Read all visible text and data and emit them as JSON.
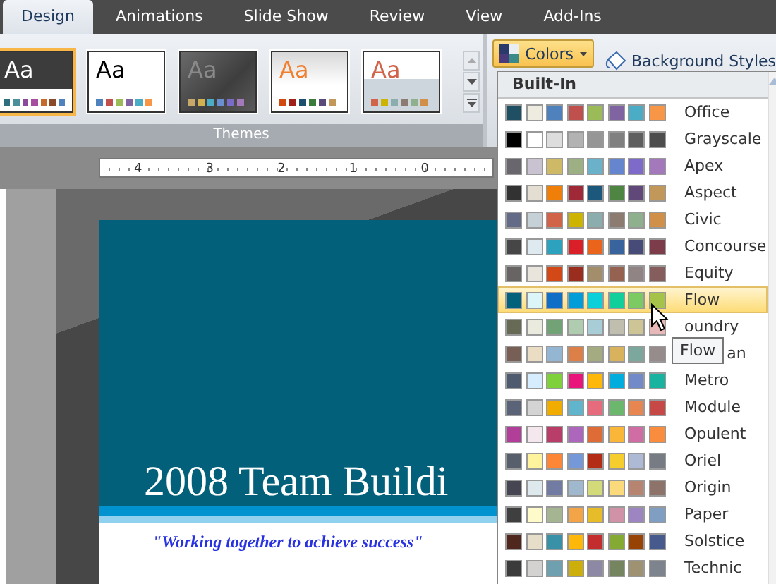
{
  "tabs": [
    {
      "label": "Design",
      "selected": true
    },
    {
      "label": "Animations",
      "selected": false
    },
    {
      "label": "Slide Show",
      "selected": false
    },
    {
      "label": "Review",
      "selected": false
    },
    {
      "label": "View",
      "selected": false
    },
    {
      "label": "Add-Ins",
      "selected": false
    }
  ],
  "themes": {
    "label": "Themes",
    "items": [
      {
        "kind": "dark_band",
        "text": "Aa",
        "selected": true,
        "swatches": [
          {
            "color": "#2e6f7f"
          },
          {
            "color": "#4a8f9a"
          },
          {
            "color": "#8a4b9a"
          },
          {
            "color": "#a64da0"
          },
          {
            "color": "#c56a2a"
          },
          {
            "color": "#8a4b2a"
          },
          {
            "color": "#4f81bd"
          }
        ]
      },
      {
        "kind": "plain",
        "text": "Aa",
        "selected": false,
        "swatches": [
          {
            "color": "#4f81bd"
          },
          {
            "color": "#c0504d"
          },
          {
            "color": "#9bbb59"
          },
          {
            "color": "#8064a2"
          },
          {
            "color": "#4bacc6"
          },
          {
            "color": "#f79646"
          }
        ]
      },
      {
        "kind": "gray",
        "text": "Aa",
        "selected": false,
        "swatches": [
          {
            "color": "#c8a868"
          },
          {
            "color": "#d0b050"
          },
          {
            "color": "#4bacc6"
          },
          {
            "color": "#6a8fd0"
          },
          {
            "color": "#7a6bc9"
          },
          {
            "color": "#a379bb"
          }
        ]
      },
      {
        "kind": "orange_fade",
        "text": "Aa",
        "selected": false,
        "swatches": [
          {
            "color": "#d04a10"
          },
          {
            "color": "#a0201a"
          },
          {
            "color": "#1b4f6c"
          },
          {
            "color": "#3a7a3a"
          },
          {
            "color": "#5a4a7a"
          },
          {
            "color": "#c19859"
          }
        ]
      },
      {
        "kind": "gray_blue",
        "text": "Aa",
        "selected": false,
        "swatches": [
          {
            "color": "#d16349"
          },
          {
            "color": "#ccb400"
          },
          {
            "color": "#8cadae"
          },
          {
            "color": "#8c7b70"
          },
          {
            "color": "#8fb08c"
          },
          {
            "color": "#d19049"
          }
        ]
      }
    ]
  },
  "colors_button": {
    "label": "Colors",
    "pressed": true
  },
  "background_styles_button": {
    "label": "Background Styles"
  },
  "ruler": {
    "labels": [
      "4",
      "3",
      "2",
      "1",
      "0"
    ]
  },
  "slide": {
    "title": "2008 Team Buildi",
    "subtitle": "\"Working together to achieve success\""
  },
  "colors_menu": {
    "header": "Built-In",
    "items": [
      {
        "label": "Office",
        "highlighted": false,
        "swatches": [
          {
            "color": "#1f4f63"
          },
          {
            "color": "#eeece1"
          },
          {
            "color": "#4f81bd"
          },
          {
            "color": "#c0504d"
          },
          {
            "color": "#9bbb59"
          },
          {
            "color": "#8064a2"
          },
          {
            "color": "#4bacc6"
          },
          {
            "color": "#f79646"
          }
        ]
      },
      {
        "label": "Grayscale",
        "highlighted": false,
        "swatches": [
          {
            "color": "#000000"
          },
          {
            "color": "#ffffff"
          },
          {
            "color": "#dddddd"
          },
          {
            "color": "#b2b2b2"
          },
          {
            "color": "#969696"
          },
          {
            "color": "#808080"
          },
          {
            "color": "#5f5f5f"
          },
          {
            "color": "#4d4d4d"
          }
        ]
      },
      {
        "label": "Apex",
        "highlighted": false,
        "swatches": [
          {
            "color": "#69676d"
          },
          {
            "color": "#c9c2d1"
          },
          {
            "color": "#ceb966"
          },
          {
            "color": "#9cb084"
          },
          {
            "color": "#6bb1c9"
          },
          {
            "color": "#6585cf"
          },
          {
            "color": "#7e6bc9"
          },
          {
            "color": "#a379bb"
          }
        ]
      },
      {
        "label": "Aspect",
        "highlighted": false,
        "swatches": [
          {
            "color": "#323232"
          },
          {
            "color": "#e3ded1"
          },
          {
            "color": "#f07f09"
          },
          {
            "color": "#9f2936"
          },
          {
            "color": "#1b587c"
          },
          {
            "color": "#4e8542"
          },
          {
            "color": "#604878"
          },
          {
            "color": "#c19859"
          }
        ]
      },
      {
        "label": "Civic",
        "highlighted": false,
        "swatches": [
          {
            "color": "#646b86"
          },
          {
            "color": "#c5d1d7"
          },
          {
            "color": "#d16349"
          },
          {
            "color": "#ccb400"
          },
          {
            "color": "#8cadae"
          },
          {
            "color": "#8c7b70"
          },
          {
            "color": "#8fb08c"
          },
          {
            "color": "#d19049"
          }
        ]
      },
      {
        "label": "Concourse",
        "highlighted": false,
        "swatches": [
          {
            "color": "#464646"
          },
          {
            "color": "#dee9f0"
          },
          {
            "color": "#2da2bf"
          },
          {
            "color": "#da1f28"
          },
          {
            "color": "#eb641b"
          },
          {
            "color": "#39639d"
          },
          {
            "color": "#474b78"
          },
          {
            "color": "#7d3c4a"
          }
        ]
      },
      {
        "label": "Equity",
        "highlighted": false,
        "swatches": [
          {
            "color": "#696464"
          },
          {
            "color": "#e9e5dc"
          },
          {
            "color": "#d34817"
          },
          {
            "color": "#9b2d1f"
          },
          {
            "color": "#a28e6a"
          },
          {
            "color": "#956251"
          },
          {
            "color": "#918485"
          },
          {
            "color": "#855d5d"
          }
        ]
      },
      {
        "label": "Flow",
        "highlighted": true,
        "swatches": [
          {
            "color": "#04617b"
          },
          {
            "color": "#dbf5f9"
          },
          {
            "color": "#0f6fc6"
          },
          {
            "color": "#009dd9"
          },
          {
            "color": "#0bd0d9"
          },
          {
            "color": "#10cf9b"
          },
          {
            "color": "#7cca62"
          },
          {
            "color": "#a5c249"
          }
        ]
      },
      {
        "label": "oundry",
        "highlighted": false,
        "swatches": [
          {
            "color": "#676a55"
          },
          {
            "color": "#eaebde"
          },
          {
            "color": "#72a376"
          },
          {
            "color": "#b0ccb0"
          },
          {
            "color": "#a8cdd7"
          },
          {
            "color": "#c0beaf"
          },
          {
            "color": "#cec597"
          },
          {
            "color": "#e8b7b7"
          }
        ]
      },
      {
        "label": "an",
        "tooltip": "Flow",
        "highlighted": false,
        "swatches": [
          {
            "color": "#775f55"
          },
          {
            "color": "#ebddc3"
          },
          {
            "color": "#94b6d2"
          },
          {
            "color": "#dd8047"
          },
          {
            "color": "#a5ab81"
          },
          {
            "color": "#d8b25c"
          },
          {
            "color": "#7ba79d"
          },
          {
            "color": "#968c8c"
          }
        ]
      },
      {
        "label": "Metro",
        "highlighted": false,
        "swatches": [
          {
            "color": "#4e5b6f"
          },
          {
            "color": "#d6ecff"
          },
          {
            "color": "#7fd13b"
          },
          {
            "color": "#ea157a"
          },
          {
            "color": "#feb80a"
          },
          {
            "color": "#00addc"
          },
          {
            "color": "#738ac8"
          },
          {
            "color": "#1ab39f"
          }
        ]
      },
      {
        "label": "Module",
        "highlighted": false,
        "swatches": [
          {
            "color": "#5a6378"
          },
          {
            "color": "#d4d4d4"
          },
          {
            "color": "#f0ad00"
          },
          {
            "color": "#60b5cc"
          },
          {
            "color": "#e66c7d"
          },
          {
            "color": "#6bb76d"
          },
          {
            "color": "#e88651"
          },
          {
            "color": "#c64847"
          }
        ]
      },
      {
        "label": "Opulent",
        "highlighted": false,
        "swatches": [
          {
            "color": "#b13f9a"
          },
          {
            "color": "#f4e7ed"
          },
          {
            "color": "#b83d68"
          },
          {
            "color": "#ac66bb"
          },
          {
            "color": "#de6c36"
          },
          {
            "color": "#f9b639"
          },
          {
            "color": "#cf6da4"
          },
          {
            "color": "#fa8d3d"
          }
        ]
      },
      {
        "label": "Oriel",
        "highlighted": false,
        "swatches": [
          {
            "color": "#575f6d"
          },
          {
            "color": "#fff39d"
          },
          {
            "color": "#fe8637"
          },
          {
            "color": "#7598d9"
          },
          {
            "color": "#b32c16"
          },
          {
            "color": "#f5cd2d"
          },
          {
            "color": "#aebad5"
          },
          {
            "color": "#777c84"
          }
        ]
      },
      {
        "label": "Origin",
        "highlighted": false,
        "swatches": [
          {
            "color": "#464653"
          },
          {
            "color": "#dde9ec"
          },
          {
            "color": "#727ca3"
          },
          {
            "color": "#9fb8cd"
          },
          {
            "color": "#d2da7a"
          },
          {
            "color": "#fada7a"
          },
          {
            "color": "#b88472"
          },
          {
            "color": "#8e736a"
          }
        ]
      },
      {
        "label": "Paper",
        "highlighted": false,
        "swatches": [
          {
            "color": "#3f3f3f"
          },
          {
            "color": "#fefac9"
          },
          {
            "color": "#a5b592"
          },
          {
            "color": "#f3a447"
          },
          {
            "color": "#e7bc29"
          },
          {
            "color": "#d092a7"
          },
          {
            "color": "#9c85c0"
          },
          {
            "color": "#809ec2"
          }
        ]
      },
      {
        "label": "Solstice",
        "highlighted": false,
        "swatches": [
          {
            "color": "#4f271c"
          },
          {
            "color": "#e7dec9"
          },
          {
            "color": "#3891a7"
          },
          {
            "color": "#feb80a"
          },
          {
            "color": "#c32d2e"
          },
          {
            "color": "#84aa33"
          },
          {
            "color": "#964305"
          },
          {
            "color": "#475a8d"
          }
        ]
      },
      {
        "label": "Technic",
        "highlighted": false,
        "swatches": [
          {
            "color": "#3b3b3b"
          },
          {
            "color": "#d4d2d0"
          },
          {
            "color": "#6ea0b0"
          },
          {
            "color": "#ccaf0a"
          },
          {
            "color": "#8d89a4"
          },
          {
            "color": "#748560"
          },
          {
            "color": "#9e9273"
          },
          {
            "color": "#7e848d"
          }
        ]
      }
    ]
  },
  "cursor": true
}
